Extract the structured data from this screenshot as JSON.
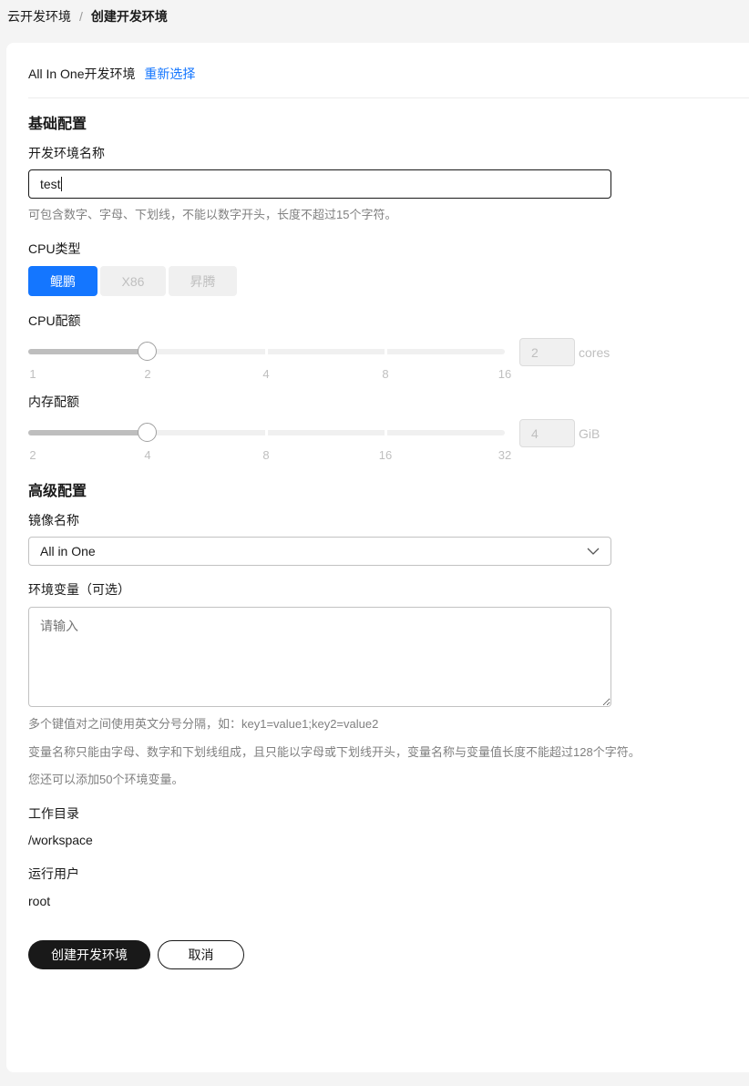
{
  "breadcrumb": {
    "parent": "云开发环境",
    "separator": "/",
    "current": "创建开发环境"
  },
  "header": {
    "env_type": "All In One开发环境",
    "reselect_link": "重新选择"
  },
  "basic": {
    "title": "基础配置",
    "name_label": "开发环境名称",
    "name_value": "test",
    "name_hint": "可包含数字、字母、下划线，不能以数字开头，长度不超过15个字符。",
    "cpu_type_label": "CPU类型",
    "cpu_types": [
      {
        "label": "鲲鹏",
        "selected": true
      },
      {
        "label": "X86",
        "selected": false
      },
      {
        "label": "昇腾",
        "selected": false
      }
    ],
    "cpu_quota": {
      "label": "CPU配额",
      "ticks": [
        "1",
        "2",
        "4",
        "8",
        "16"
      ],
      "value": "2",
      "selected_index": 1,
      "unit": "cores"
    },
    "mem_quota": {
      "label": "内存配额",
      "ticks": [
        "2",
        "4",
        "8",
        "16",
        "32"
      ],
      "value": "4",
      "selected_index": 1,
      "unit": "GiB"
    }
  },
  "advanced": {
    "title": "高级配置",
    "image_label": "镜像名称",
    "image_value": "All in One",
    "env_label": "环境变量（可选）",
    "env_placeholder": "请输入",
    "hints": [
      "多个键值对之间使用英文分号分隔，如：key1=value1;key2=value2",
      "变量名称只能由字母、数字和下划线组成，且只能以字母或下划线开头，变量名称与变量值长度不能超过128个字符。",
      "您还可以添加50个环境变量。"
    ],
    "workdir_label": "工作目录",
    "workdir_value": "/workspace",
    "user_label": "运行用户",
    "user_value": "root"
  },
  "actions": {
    "create": "创建开发环境",
    "cancel": "取消"
  },
  "colors": {
    "accent": "#1476ff",
    "primary_button": "#191919"
  }
}
